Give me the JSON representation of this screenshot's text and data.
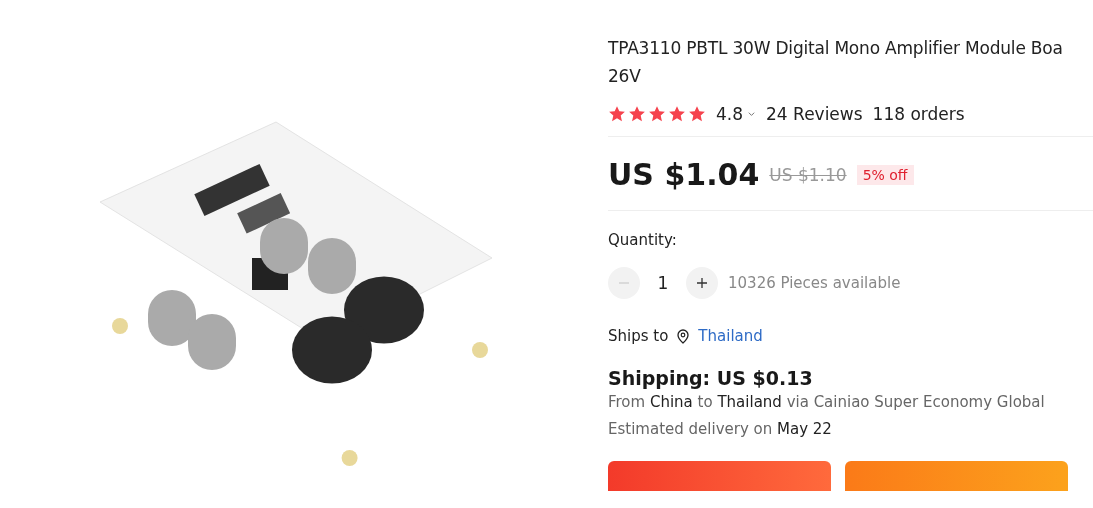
{
  "product": {
    "title_lines": [
      "TPA3110 PBTL 30W Digital Mono Amplifier Module Boa",
      "26V"
    ],
    "rating": {
      "stars": 5,
      "score": "4.8",
      "reviews": "24 Reviews",
      "orders": "118 orders"
    },
    "price": {
      "current": "US $1.04",
      "original": "US $1.10",
      "discount": "5% off"
    },
    "quantity": {
      "label": "Quantity:",
      "value": "1",
      "minus_disabled": true,
      "available": "10326 Pieces available"
    },
    "ships_to": {
      "label": "Ships to",
      "country": "Thailand"
    },
    "shipping": {
      "title": "Shipping: US $0.13",
      "route": [
        {
          "text": "From",
          "strong": false
        },
        {
          "text": "China",
          "strong": true
        },
        {
          "text": "to",
          "strong": false
        },
        {
          "text": "Thailand",
          "strong": true
        },
        {
          "text": "via Cainiao Super Economy Global",
          "strong": false
        }
      ],
      "delivery": [
        {
          "text": "Estimated delivery on",
          "strong": false
        },
        {
          "text": "May 22",
          "strong": true
        }
      ]
    },
    "buttons": [
      {
        "kind": "buy"
      },
      {
        "kind": "cart"
      }
    ]
  }
}
